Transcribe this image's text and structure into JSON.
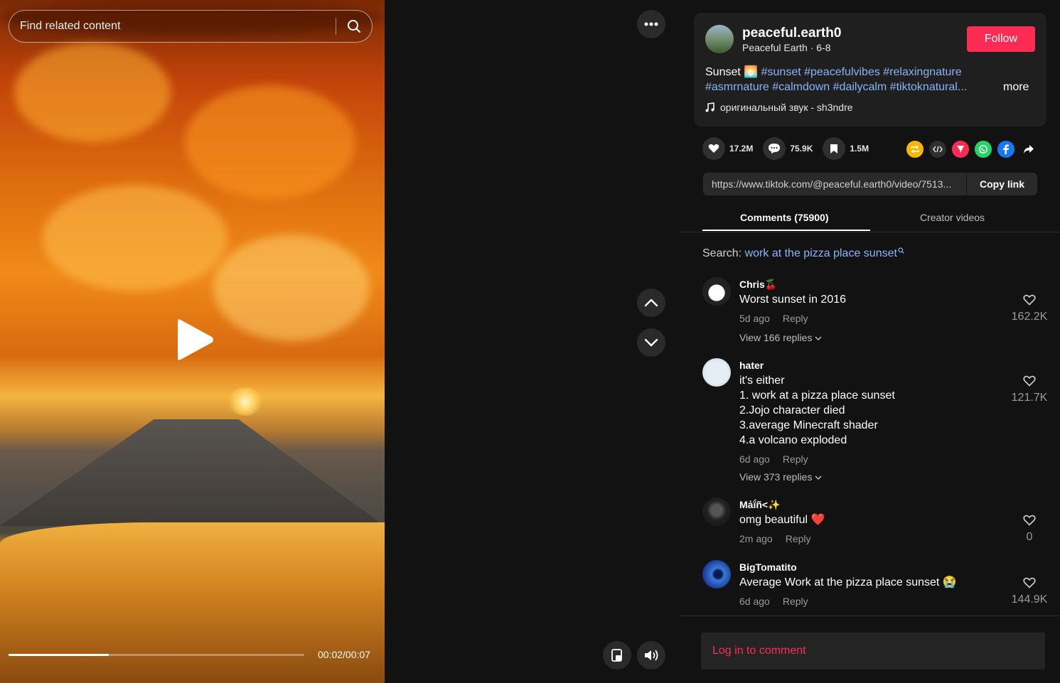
{
  "video": {
    "search_placeholder": "Find related content",
    "time": "00:02/00:07",
    "progress_fraction": 0.34
  },
  "author": {
    "name": "peaceful.earth0",
    "subtitle": "Peaceful Earth · 6-8",
    "follow_label": "Follow"
  },
  "description": {
    "text_prefix": "Sunset 🌅 ",
    "line1_tags": "#sunset #peacefulvibes #relaxingnature",
    "line2_tags": "#asmrnature #calmdown #dailycalm #tiktoknatural...",
    "more_label": "more",
    "music": "оригинальный звук - sh3ndre"
  },
  "actions": {
    "likes": "17.2M",
    "comments": "75.9K",
    "saves": "1.5M"
  },
  "share": {
    "link": "https://www.tiktok.com/@peaceful.earth0/video/7513...",
    "copy_label": "Copy link",
    "colors": {
      "repost": "#f5b800",
      "embed": "#2f2f2f",
      "send": "#fe2c55",
      "whatsapp": "#25d366",
      "facebook": "#1877f2"
    }
  },
  "tabs": {
    "comments": "Comments (75900)",
    "creator": "Creator videos"
  },
  "search_hint": {
    "label": "Search: ",
    "query": "work at the pizza place sunset"
  },
  "comments": [
    {
      "user": "Chris🍒",
      "text": "Worst sunset in 2016",
      "time": "5d ago",
      "reply": "Reply",
      "likes": "162.2K",
      "view": "View 166 replies"
    },
    {
      "user": "hater",
      "text": "it's either\n1. work at a pizza place sunset\n2.Jojo character died\n3.average Minecraft shader\n4.a volcano exploded",
      "time": "6d ago",
      "reply": "Reply",
      "likes": "121.7K",
      "view": "View 373 replies"
    },
    {
      "user": "Mảḯñ<✨",
      "text": "omg beautiful ❤️",
      "time": "2m ago",
      "reply": "Reply",
      "likes": "0"
    },
    {
      "user": "BigTomatito",
      "text": "Average Work at the pizza place sunset 😭",
      "time": "6d ago",
      "reply": "Reply",
      "likes": "144.9K"
    }
  ],
  "login": {
    "label": "Log in to comment"
  },
  "colors": {
    "accent": "#fe2c55",
    "link": "#8ab4f8"
  }
}
